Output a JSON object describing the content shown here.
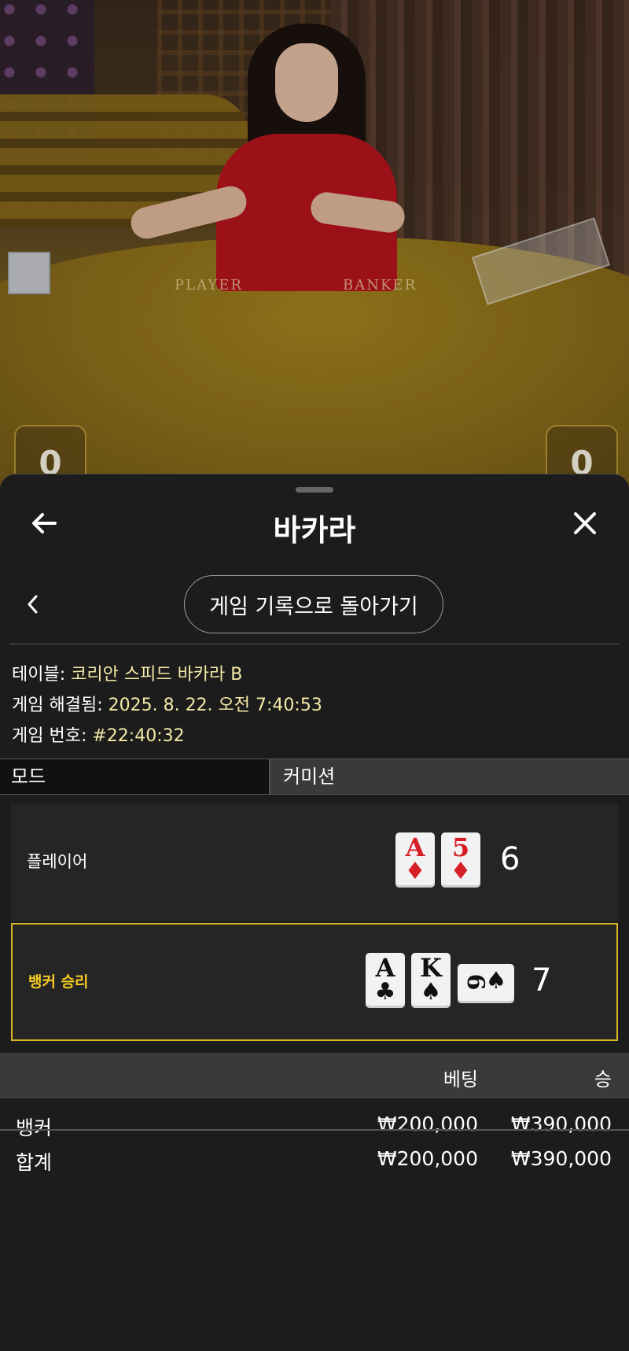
{
  "header": {
    "title": "바카라"
  },
  "history_button": "게임 기록으로 돌아가기",
  "info": {
    "table_label": "테이블:",
    "table_value": "코리안 스피드 바카라 B",
    "resolved_label": "게임 해결됨:",
    "resolved_value": "2025. 8. 22. 오전 7:40:53",
    "game_no_label": "게임 번호:",
    "game_no_value": "#22:40:32"
  },
  "mode_bar": {
    "mode": "모드",
    "commission": "커미션"
  },
  "video": {
    "felt_player": "PLAYER",
    "felt_banker": "BANKER",
    "left_score": "0",
    "right_score": "0"
  },
  "hands": [
    {
      "label": "플레이어",
      "winner": false,
      "total": "6",
      "cards": [
        {
          "rank": "A",
          "suit": "♦",
          "color": "red"
        },
        {
          "rank": "5",
          "suit": "♦",
          "color": "red"
        }
      ]
    },
    {
      "label": "뱅커 승리",
      "winner": true,
      "total": "7",
      "cards": [
        {
          "rank": "A",
          "suit": "♣",
          "color": "black"
        },
        {
          "rank": "K",
          "suit": "♠",
          "color": "black"
        },
        {
          "rank": "6",
          "suit": "♠",
          "color": "black",
          "sideways": true
        }
      ]
    }
  ],
  "bets_table": {
    "headers": [
      "",
      "베팅",
      "승"
    ],
    "rows": [
      {
        "name": "뱅커",
        "bet": "₩200,000",
        "win": "₩390,000"
      },
      {
        "name": "합계",
        "bet": "₩200,000",
        "win": "₩390,000"
      }
    ]
  },
  "colors": {
    "winner_accent": "#d8b524",
    "winner_text": "#f5cb23",
    "value_text": "#f4e9a6",
    "sheet_bg": "#1c1c1c"
  },
  "icons": {
    "back": "arrow-left-icon",
    "close": "close-icon",
    "chevron": "chevron-left-icon"
  }
}
